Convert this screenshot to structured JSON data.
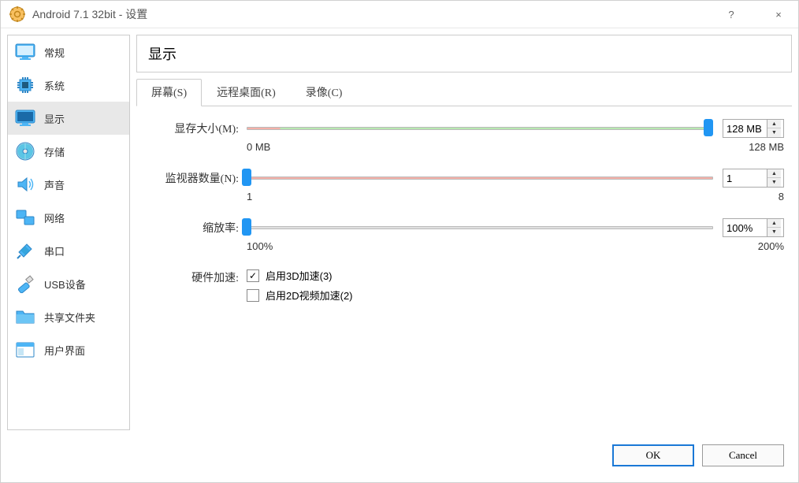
{
  "window": {
    "title": "Android 7.1 32bit - 设置",
    "help": "?",
    "close": "×"
  },
  "sidebar": {
    "items": [
      {
        "label": "常规"
      },
      {
        "label": "系统"
      },
      {
        "label": "显示"
      },
      {
        "label": "存储"
      },
      {
        "label": "声音"
      },
      {
        "label": "网络"
      },
      {
        "label": "串口"
      },
      {
        "label": "USB设备"
      },
      {
        "label": "共享文件夹"
      },
      {
        "label": "用户界面"
      }
    ],
    "selected_index": 2
  },
  "content": {
    "header": "显示",
    "tabs": [
      {
        "label": "屏幕(S)"
      },
      {
        "label": "远程桌面(R)"
      },
      {
        "label": "录像(C)"
      }
    ],
    "active_tab": 0,
    "settings": {
      "vmem": {
        "label": "显存大小(M):",
        "min_label": "0 MB",
        "max_label": "128 MB",
        "value": "128 MB",
        "position": 99
      },
      "monitors": {
        "label": "监视器数量(N):",
        "min_label": "1",
        "max_label": "8",
        "value": "1",
        "position": 0
      },
      "scale": {
        "label": "缩放率:",
        "min_label": "100%",
        "max_label": "200%",
        "value": "100%",
        "position": 0
      },
      "hwaccel": {
        "label": "硬件加速:",
        "option1": "启用3D加速(3)",
        "option1_checked": true,
        "option2": "启用2D视频加速(2)",
        "option2_checked": false
      }
    }
  },
  "footer": {
    "ok": "OK",
    "cancel": "Cancel"
  }
}
